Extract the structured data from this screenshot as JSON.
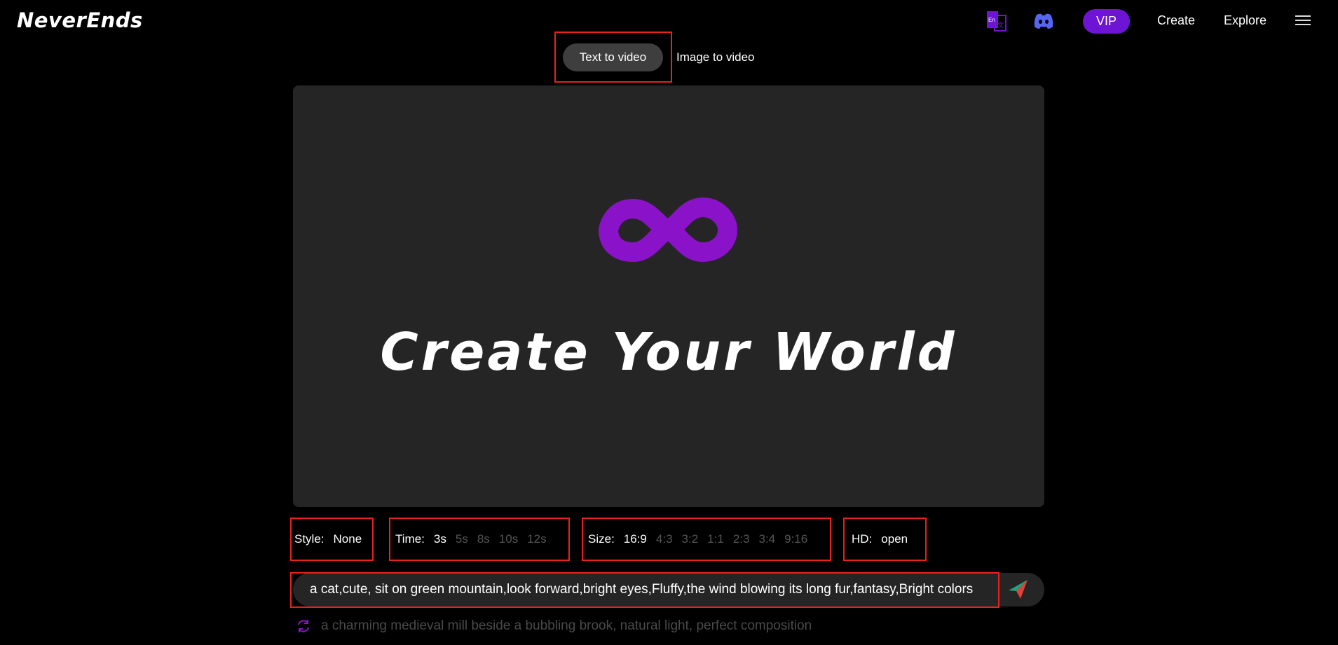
{
  "header": {
    "logo": "NeverEnds",
    "vip": "VIP",
    "create": "Create",
    "explore": "Explore",
    "icons": [
      "translate-icon",
      "discord-icon",
      "menu-icon"
    ]
  },
  "mode_tabs": {
    "text_to_video": "Text to video",
    "image_to_video": "Image to video",
    "active": "Text to video"
  },
  "preview": {
    "tagline": "Create Your World",
    "logo_color": "#8a12c9"
  },
  "options": {
    "style": {
      "label": "Style:",
      "value": "None"
    },
    "time": {
      "label": "Time:",
      "values": [
        "3s",
        "5s",
        "8s",
        "10s",
        "12s"
      ],
      "selected": "3s"
    },
    "size": {
      "label": "Size:",
      "values": [
        "16:9",
        "4:3",
        "3:2",
        "1:1",
        "2:3",
        "3:4",
        "9:16"
      ],
      "selected": "16:9"
    },
    "hd": {
      "label": "HD:",
      "value": "open"
    }
  },
  "prompt": {
    "value": "a cat,cute, sit on green mountain,look forward,bright eyes,Fluffy,the wind blowing its long fur,fantasy,Bright colors"
  },
  "suggestion": {
    "text": "a charming medieval mill beside a bubbling brook, natural light, perfect composition"
  },
  "colors": {
    "accent": "#6e14d4",
    "highlight": "#e8211c"
  }
}
